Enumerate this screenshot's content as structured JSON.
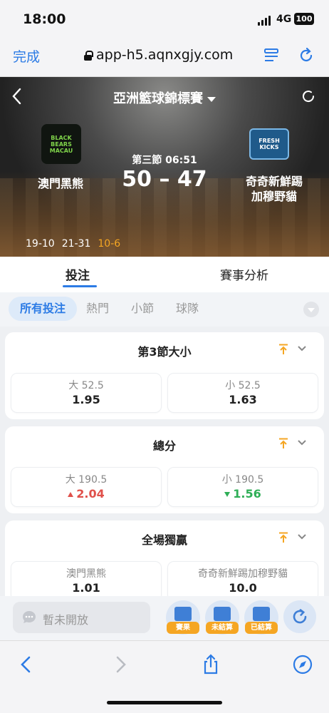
{
  "status_bar": {
    "time": "18:00",
    "network": "4G",
    "battery": "100"
  },
  "browser": {
    "done_label": "完成",
    "url": "app-h5.aqnxgjy.com"
  },
  "match": {
    "league": "亞洲籃球錦標賽",
    "home": {
      "name": "澳門黑熊",
      "logo_text": "BLACK BEARS MACAU"
    },
    "away": {
      "name_line1": "奇奇新鮮踢",
      "name_line2": "加穆野貓",
      "logo_text": "FRESH KICKS"
    },
    "period": "第三節  06:51",
    "score": "50 – 47",
    "quarter_scores": [
      "19-10",
      "21-31",
      "10-6"
    ]
  },
  "tabs": [
    {
      "label": "投注"
    },
    {
      "label": "賽事分析"
    }
  ],
  "filters": [
    {
      "label": "所有投注"
    },
    {
      "label": "熱門"
    },
    {
      "label": "小節"
    },
    {
      "label": "球隊"
    }
  ],
  "markets": [
    {
      "title": "第3節大小",
      "options": [
        {
          "label": "大 52.5",
          "value": "1.95",
          "trend": "none"
        },
        {
          "label": "小 52.5",
          "value": "1.63",
          "trend": "none"
        }
      ]
    },
    {
      "title": "總分",
      "options": [
        {
          "label": "大 190.5",
          "value": "2.04",
          "trend": "up"
        },
        {
          "label": "小 190.5",
          "value": "1.56",
          "trend": "down"
        }
      ]
    },
    {
      "title": "全場獨贏",
      "options": [
        {
          "label": "澳門黑熊",
          "value": "1.01",
          "trend": "none"
        },
        {
          "label": "奇奇新鮮踢加穆野貓",
          "value": "10.0",
          "trend": "none"
        }
      ]
    }
  ],
  "action_bar": {
    "chat_placeholder": "暫未開放",
    "buttons": [
      {
        "label": "賽果"
      },
      {
        "label": "未結算"
      },
      {
        "label": "已結算"
      }
    ]
  },
  "colors": {
    "accent": "#2c7be5",
    "up": "#e0504a",
    "down": "#2fae57",
    "highlight": "#f5a623"
  }
}
